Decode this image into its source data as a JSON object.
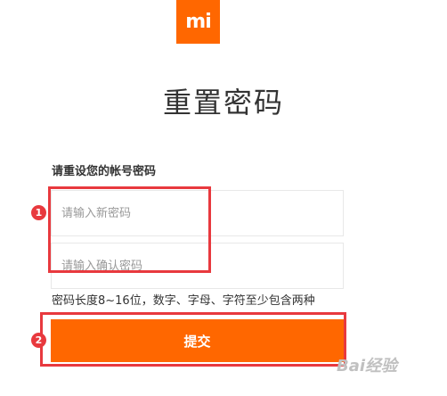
{
  "logo": {
    "text": "mi"
  },
  "title": "重置密码",
  "form": {
    "label": "请重设您的帐号密码",
    "new_password_placeholder": "请输入新密码",
    "confirm_password_placeholder": "请输入确认密码",
    "hint": "密码长度8~16位，数字、字母、字符至少包含两种",
    "submit_label": "提交"
  },
  "annotations": {
    "badge_1": "1",
    "badge_2": "2"
  },
  "watermark": "Bai经验",
  "colors": {
    "brand": "#ff6700",
    "annotation": "#e8393e"
  }
}
